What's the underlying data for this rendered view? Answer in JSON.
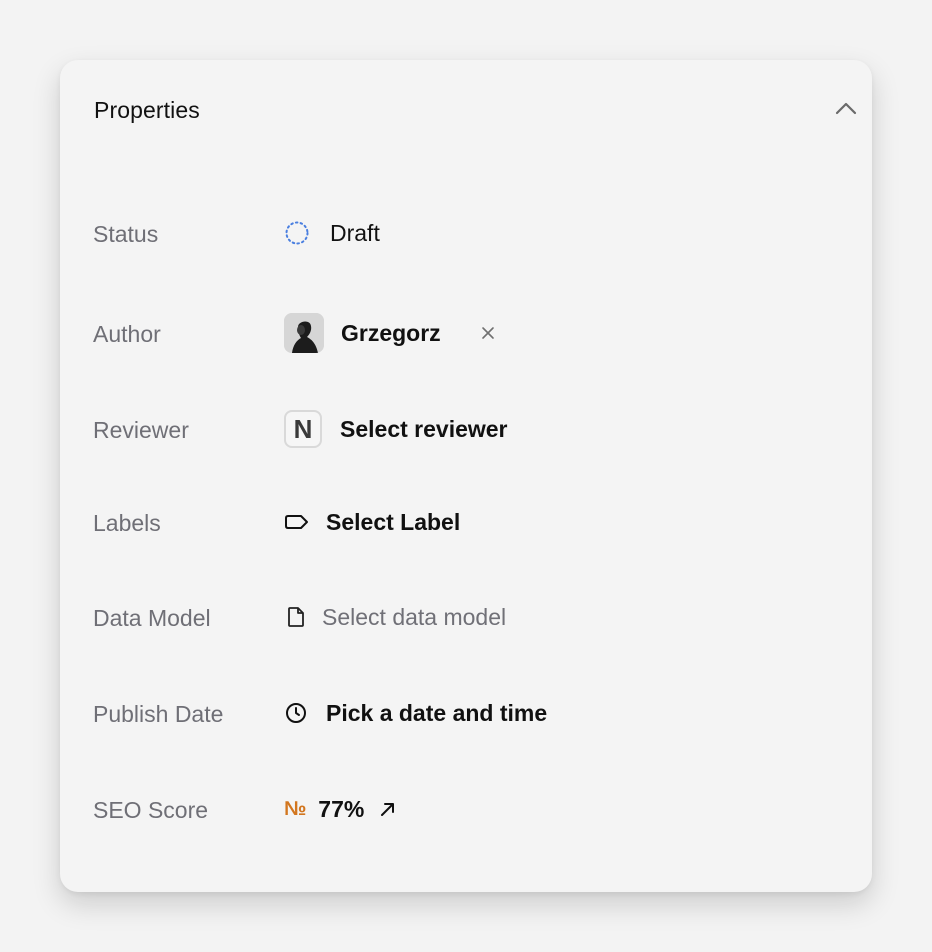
{
  "panel": {
    "title": "Properties"
  },
  "rows": {
    "status": {
      "label": "Status",
      "value": "Draft",
      "icon": "dotted-circle-icon",
      "icon_color": "#4a7fe0"
    },
    "author": {
      "label": "Author",
      "value": "Grzegorz",
      "icon": "avatar"
    },
    "reviewer": {
      "label": "Reviewer",
      "value": "Select reviewer",
      "icon": "n-badge-icon",
      "badge": "N"
    },
    "labels": {
      "label": "Labels",
      "value": "Select Label",
      "icon": "tag-icon"
    },
    "data_model": {
      "label": "Data Model",
      "value": "Select data model",
      "icon": "file-icon"
    },
    "publish_date": {
      "label": "Publish Date",
      "value": "Pick a date and time",
      "icon": "clock-icon"
    },
    "seo_score": {
      "label": "SEO Score",
      "value": "77%",
      "prefix": "№",
      "prefix_color": "#d2761f",
      "icon": "arrow-up-right-icon"
    }
  }
}
